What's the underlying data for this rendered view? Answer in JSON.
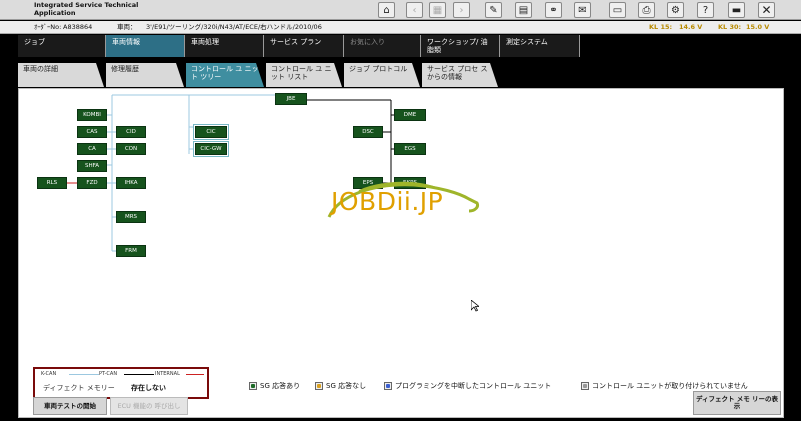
{
  "app": {
    "title": "Integrated Service Technical Application"
  },
  "info": {
    "order_label": "ｵｰﾀﾞｰNo:",
    "order_value": "A838864",
    "vehicle_label": "車両：",
    "vehicle_value": "3'/E91/ツーリング/320i/N43/AT/ECE/右ハンドル/2010/06",
    "kl15_label": "KL 15:",
    "kl15_value": "14.6 V",
    "kl30_label": "KL 30:",
    "kl30_value": "15.0 V"
  },
  "nav": [
    "ジョブ",
    "車両情報",
    "車両処理",
    "サービス プラン",
    "お気に入り",
    "ワークショップ/ 油脂類",
    "測定システム"
  ],
  "subtabs": [
    "車両の詳細",
    "修理履歴",
    "コントロール ユ ニット ツリー",
    "コントロール ユ ニット リスト",
    "ジョブ プロトコル",
    "サービス プロセ スからの情報"
  ],
  "ecus": {
    "jbe": "JBE",
    "kombi": "KOMBI",
    "cas": "CAS",
    "ca": "CA",
    "shd": "SHFA",
    "rls": "RLS",
    "fzd": "FZD",
    "cid": "CID",
    "con": "CON",
    "ihka": "IHKA",
    "mrs": "MRS",
    "frm": "FRM",
    "cic": "CIC",
    "cic_gw": "CIC-GW",
    "dsc": "DSC",
    "dme": "DME",
    "egs": "EGS",
    "eps": "EPS",
    "ekps": "EKPS"
  },
  "legend": {
    "kcan": "K-CAN",
    "ptcan": "PT-CAN",
    "internal": "INTERNAL",
    "fault_memory_label": "ディフェクト メモリー",
    "fault_memory_value": "存在しない"
  },
  "status_legend": [
    {
      "label": "SG 応答あり",
      "color": "#1d6b28"
    },
    {
      "label": "SG 応答なし",
      "color": "#d9a020"
    },
    {
      "label": "プログラミングを中断したコントロール ユニット",
      "color": "#3b5fd0"
    },
    {
      "label": "コントロール ユニットが取り付けられていません",
      "color": "#999999"
    }
  ],
  "buttons": {
    "vehicle_test": "車両テストの開始",
    "ecu_call": "ECU 機能の 呼び出し",
    "show_fault_memory": "ディフェクト メモ リーの表示"
  },
  "watermark": "JOBDii.JP",
  "colors": {
    "ecu_green": "#16531d",
    "active_nav": "#2d6f86",
    "active_tab": "#3f8ea0",
    "kcan_line": "#9cc8e0",
    "ptcan_line": "#000000",
    "internal_line": "#cc2222"
  }
}
